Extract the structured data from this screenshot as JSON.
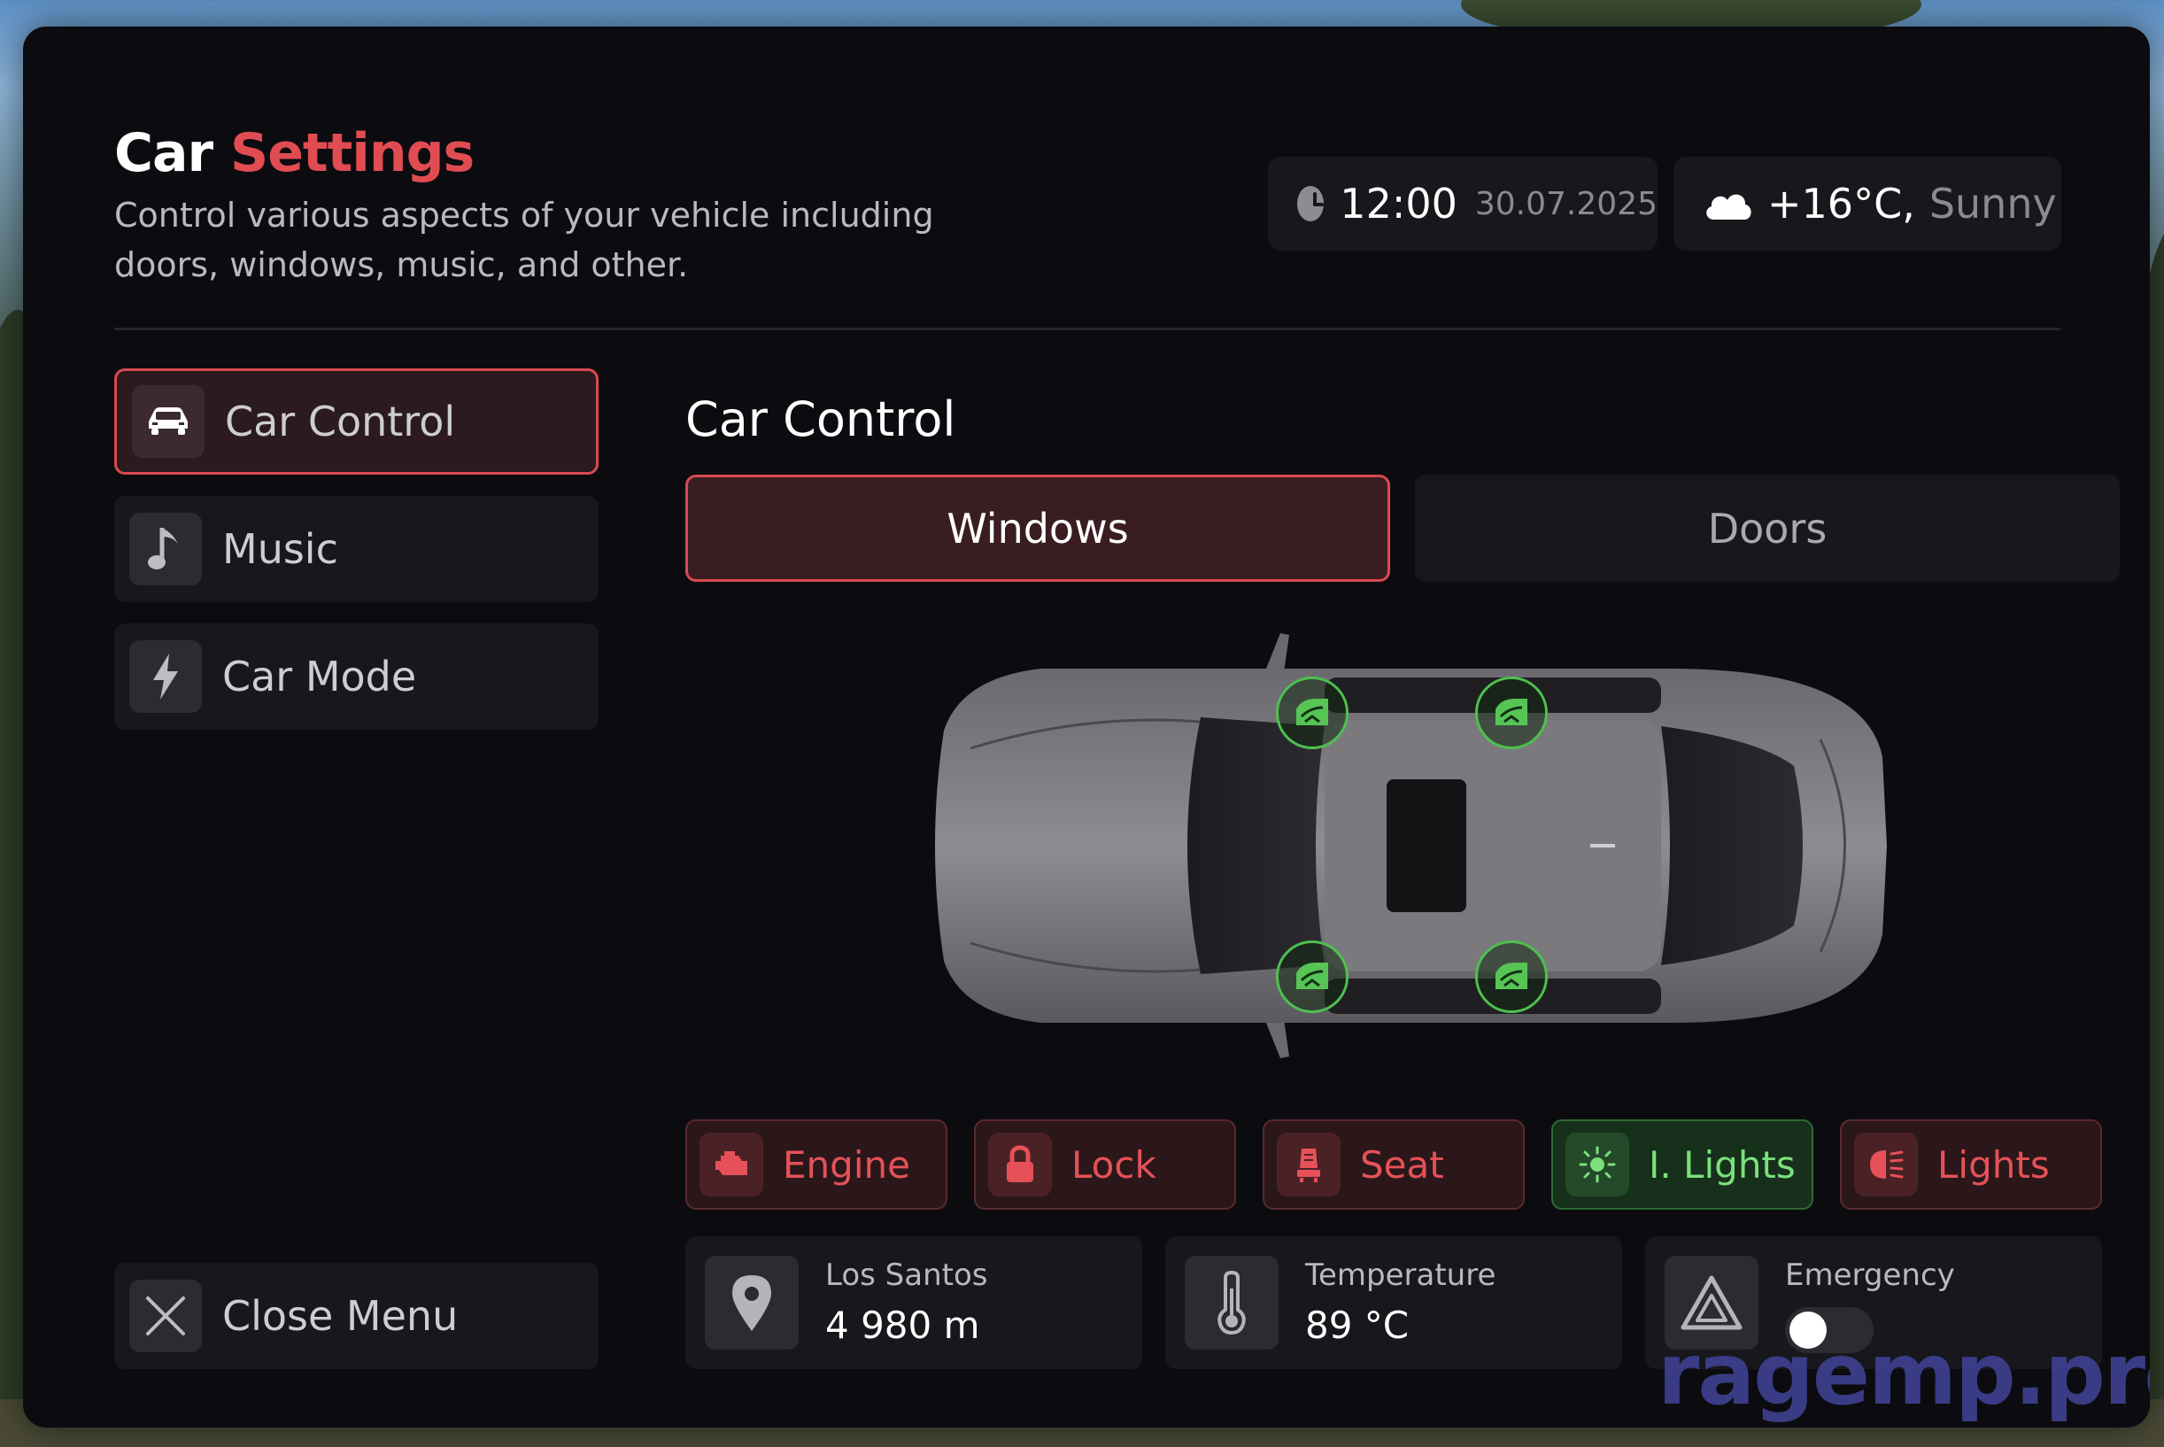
{
  "header": {
    "title_part1": "Car",
    "title_part2": "Settings",
    "subtitle": "Control various aspects of your vehicle including doors, windows, music, and other."
  },
  "clock": {
    "time": "12:00",
    "date": "30.07.2025",
    "icon": "clock-icon"
  },
  "weather": {
    "temperature": "+16°C,",
    "condition": "Sunny",
    "icon": "cloud-icon"
  },
  "sidebar": {
    "items": [
      {
        "label": "Car Control",
        "icon": "car-icon",
        "active": true
      },
      {
        "label": "Music",
        "icon": "music-note-icon",
        "active": false
      },
      {
        "label": "Car Mode",
        "icon": "lightning-icon",
        "active": false
      }
    ],
    "close_label": "Close Menu"
  },
  "main": {
    "section_title": "Car Control",
    "tabs": [
      {
        "label": "Windows",
        "active": true
      },
      {
        "label": "Doors",
        "active": false
      }
    ],
    "windows": [
      "front-left",
      "rear-left",
      "front-right",
      "rear-right"
    ]
  },
  "actions": [
    {
      "label": "Engine",
      "icon": "engine-icon",
      "state": "off"
    },
    {
      "label": "Lock",
      "icon": "lock-icon",
      "state": "off"
    },
    {
      "label": "Seat",
      "icon": "seat-icon",
      "state": "off"
    },
    {
      "label": "I. Lights",
      "icon": "sun-icon",
      "state": "on"
    },
    {
      "label": "Lights",
      "icon": "headlight-icon",
      "state": "off"
    }
  ],
  "info": {
    "location": {
      "label": "Los Santos",
      "value": "4 980 m",
      "icon": "map-pin-icon"
    },
    "temperature": {
      "label": "Temperature",
      "value": "89 °C",
      "icon": "thermometer-icon"
    },
    "emergency": {
      "label": "Emergency",
      "enabled": false,
      "icon": "warning-triangle-icon"
    }
  },
  "watermark": "ragemp.pro",
  "colors": {
    "accent": "#e14b52",
    "green": "#4fc04f",
    "panel": "#0c0c10",
    "card": "#17171c"
  }
}
